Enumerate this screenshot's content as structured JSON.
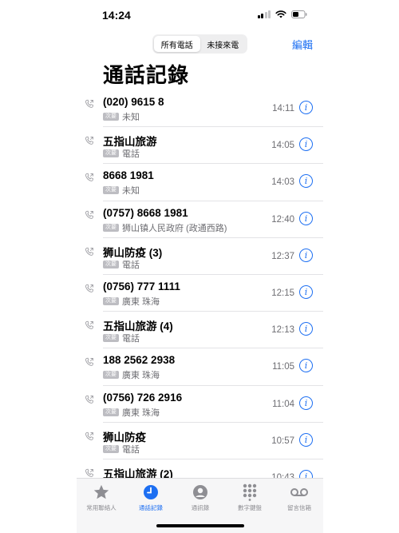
{
  "status_bar": {
    "time": "14:24"
  },
  "header": {
    "segments": [
      {
        "label": "所有電話",
        "active": true
      },
      {
        "label": "未接來電",
        "active": false
      }
    ],
    "edit_label": "編輯",
    "title": "通話記錄"
  },
  "calls": [
    {
      "name": "(020) 9615 8",
      "tag": "次要",
      "detail": "未知",
      "time": "14:11"
    },
    {
      "name": "五指山旅游",
      "tag": "次要",
      "detail": "電話",
      "time": "14:05"
    },
    {
      "name": "8668 1981",
      "tag": "次要",
      "detail": "未知",
      "time": "14:03"
    },
    {
      "name": "(0757) 8668 1981",
      "tag": "次要",
      "detail": "狮山镇人民政府 (政通西路)",
      "time": "12:40"
    },
    {
      "name": "狮山防疫 (3)",
      "tag": "次要",
      "detail": "電話",
      "time": "12:37"
    },
    {
      "name": "(0756) 777 1111",
      "tag": "次要",
      "detail": "廣東 珠海",
      "time": "12:15"
    },
    {
      "name": "五指山旅游 (4)",
      "tag": "次要",
      "detail": "電話",
      "time": "12:13"
    },
    {
      "name": "188 2562 2938",
      "tag": "次要",
      "detail": "廣東 珠海",
      "time": "11:05"
    },
    {
      "name": "(0756) 726 2916",
      "tag": "次要",
      "detail": "廣東 珠海",
      "time": "11:04"
    },
    {
      "name": "狮山防疫",
      "tag": "次要",
      "detail": "電話",
      "time": "10:57"
    },
    {
      "name": "五指山旅游 (2)",
      "tag": "",
      "detail": "",
      "time": "10:43"
    }
  ],
  "tab_bar": {
    "tabs": [
      {
        "label": "常用聯絡人",
        "icon": "star-icon",
        "active": false
      },
      {
        "label": "通話記錄",
        "icon": "clock-icon",
        "active": true
      },
      {
        "label": "通訊錄",
        "icon": "contact-icon",
        "active": false
      },
      {
        "label": "數字鍵盤",
        "icon": "keypad-icon",
        "active": false
      },
      {
        "label": "留言信箱",
        "icon": "voicemail-icon",
        "active": false
      }
    ]
  },
  "colors": {
    "accent": "#1d6ff2",
    "secondary_text": "#6d6d72",
    "tag_bg": "#bdbdc2"
  }
}
